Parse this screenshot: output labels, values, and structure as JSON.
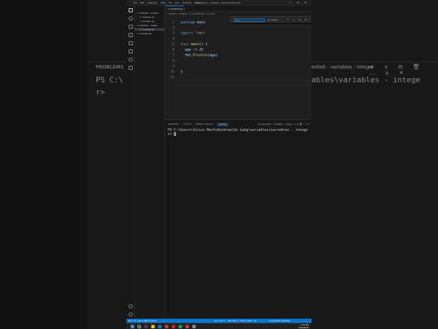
{
  "background": {
    "problems_label": "PROBLEMS",
    "terminal_line_1": "PS C:\\",
    "terminal_line_2": "r> ",
    "right_label": "eshell - variables - integer",
    "right_path": "ables\\variables - intege",
    "right_icons": "+ ∨ ⊟ 🗑 … ∧ ✕"
  },
  "window": {
    "title": "variables.go - variables - Visual Studio Code",
    "menu": [
      "File",
      "Edit",
      "Selection",
      "View",
      "Go",
      "Run",
      "Terminal",
      "Help"
    ],
    "controls": "— ☐ ✕"
  },
  "sidebar": {
    "items": [
      {
        "label": "∨ variables - boolean"
      },
      {
        "label": "∨ variables.go"
      },
      {
        "label": "∨ variables.go"
      },
      {
        "label": "∨ variables - integer"
      },
      {
        "label": "∨ variables.go"
      },
      {
        "label": "∨ variables.go"
      }
    ]
  },
  "editor": {
    "tab_label": "∞ variables.go ×",
    "breadcrumb": "variables - integer > ∞ variables.go > ◎ main",
    "find": {
      "placeholder": "Find",
      "results": "No results",
      "icons": "↑ ↓ ≡ ✕"
    },
    "line_numbers": [
      "1",
      "2",
      "3",
      "4",
      "5",
      "6",
      "7",
      "8",
      "9",
      "10",
      "11"
    ],
    "lines": [
      {
        "parts": [
          [
            "kw",
            "package "
          ],
          [
            "plain",
            "main"
          ]
        ]
      },
      {
        "parts": []
      },
      {
        "parts": [
          [
            "kw",
            "import "
          ],
          [
            "str",
            "\"fmt\""
          ]
        ]
      },
      {
        "parts": []
      },
      {
        "parts": [
          [
            "kw",
            "func "
          ],
          [
            "fn",
            "main"
          ],
          [
            "plain",
            "() "
          ],
          [
            "br",
            "{"
          ]
        ]
      },
      {
        "parts": [
          [
            "var",
            "  age"
          ],
          [
            "plain",
            " := "
          ],
          [
            "num",
            "25"
          ]
        ]
      },
      {
        "parts": [
          [
            "var",
            "  fmt"
          ],
          [
            "plain",
            "."
          ],
          [
            "fn",
            "Println"
          ],
          [
            "plain",
            "("
          ],
          [
            "var",
            "age"
          ],
          [
            "plain",
            ")"
          ]
        ]
      },
      {
        "parts": []
      },
      {
        "parts": []
      },
      {
        "parts": [
          [
            "br",
            "}"
          ]
        ]
      },
      {
        "parts": []
      }
    ]
  },
  "panel": {
    "tabs": [
      "PROBLEMS",
      "OUTPUT",
      "DEBUG CONSOLE",
      "TERMINAL"
    ],
    "active_tab": "TERMINAL",
    "right": "⊡ powershell - variables - integer  +  ∨  ⊟  🗑  …  ∧  ✕",
    "terminal_line_1": "PS C:\\Users\\Julius Mark\\Desktop\\Go Lang\\variables\\variables - intege",
    "terminal_line_2": "r> "
  },
  "statusbar": {
    "left": "⊗ 0 ⚠ 0",
    "remote": "Julius Mark's Class",
    "position": "Ln 1, Col 1",
    "spaces": "Tab Size: 4",
    "encoding": "UTF-8",
    "eol": "CRLF",
    "language": "Go",
    "go_version": "Go Update Available"
  },
  "taskbar": {
    "time": "9:25 PM",
    "date": "7/16/2025"
  }
}
